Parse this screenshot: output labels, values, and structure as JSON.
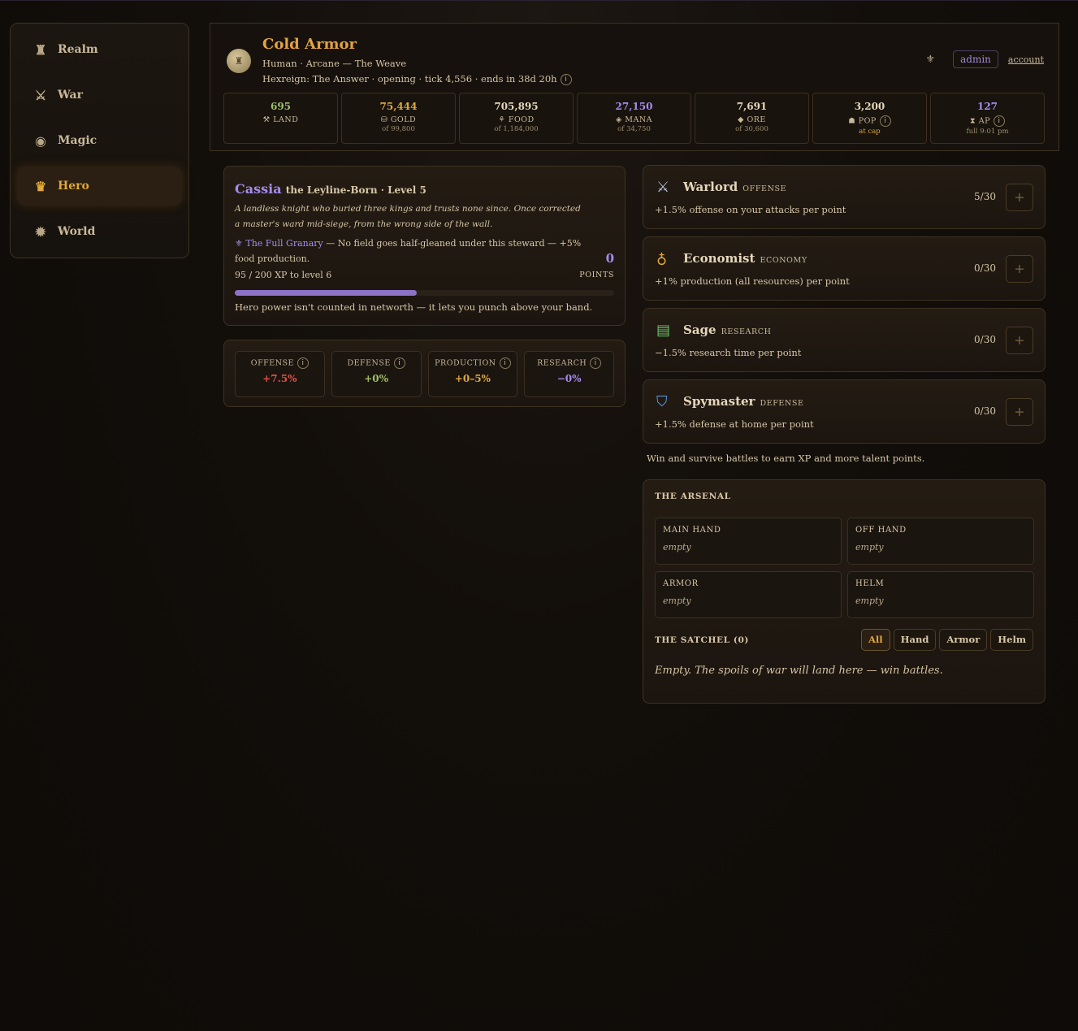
{
  "nav": {
    "items": [
      {
        "label": "Realm",
        "icon": "castle-icon"
      },
      {
        "label": "War",
        "icon": "crossed-swords-icon"
      },
      {
        "label": "Magic",
        "icon": "crystal-ball-icon"
      },
      {
        "label": "Hero",
        "icon": "laurel-icon",
        "active": true
      },
      {
        "label": "World",
        "icon": "compass-icon"
      }
    ]
  },
  "header": {
    "kingdom_name": "Cold Armor",
    "subtitle": "Human · Arcane — The Weave",
    "status": "Hexreign: The Answer · opening · tick 4,556 · ends in 38d 20h",
    "admin_label": "admin",
    "account_label": "account"
  },
  "stats": [
    {
      "value": "695",
      "label": "LAND",
      "sub": "",
      "color": "#9fbf6a"
    },
    {
      "value": "75,444",
      "label": "GOLD",
      "sub": "of 99,800",
      "color": "#e0a73a"
    },
    {
      "value": "705,895",
      "label": "FOOD",
      "sub": "of 1,184,000",
      "color": "#e6d7bb"
    },
    {
      "value": "27,150",
      "label": "MANA",
      "sub": "of 34,750",
      "color": "#a58cf0"
    },
    {
      "value": "7,691",
      "label": "ORE",
      "sub": "of 30,600",
      "color": "#e6d7bb"
    },
    {
      "value": "3,200",
      "label": "POP",
      "sub": "at cap",
      "color": "#e6d7bb"
    },
    {
      "value": "127",
      "label": "AP",
      "sub": "full 9:01 pm",
      "color": "#a58cf0"
    }
  ],
  "hero": {
    "name": "Cassia",
    "title_rest": "the Leyline-Born · Level 5",
    "bio": "A landless knight who buried three kings and trusts none since. Once corrected a master's ward mid-siege, from the wrong side of the wall.",
    "trait_name": "The Full Granary",
    "trait_desc": "— No field goes half-gleaned under this steward — +5% food production.",
    "points": "0",
    "points_label": "POINTS",
    "xp_text": "95 / 200 XP to level 6",
    "xp_fraction": 0.48,
    "note": "Hero power isn't counted in networth — it lets you punch above your band."
  },
  "modifiers": [
    {
      "label": "OFFENSE",
      "value": "+7.5%",
      "color": "#e0514a"
    },
    {
      "label": "DEFENSE",
      "value": "+0%",
      "color": "#9fbf6a"
    },
    {
      "label": "PRODUCTION",
      "value": "+0–5%",
      "color": "#e0a73a"
    },
    {
      "label": "RESEARCH",
      "value": "−0%",
      "color": "#a58cf0"
    }
  ],
  "talents": [
    {
      "name": "Warlord",
      "category": "OFFENSE",
      "desc": "+1.5% offense on your attacks per point",
      "count": "5/30",
      "icon": "swords-icon"
    },
    {
      "name": "Economist",
      "category": "ECONOMY",
      "desc": "+1% production (all resources) per point",
      "count": "0/30",
      "icon": "money-bag-icon"
    },
    {
      "name": "Sage",
      "category": "RESEARCH",
      "desc": "−1.5% research time per point",
      "count": "0/30",
      "icon": "books-icon"
    },
    {
      "name": "Spymaster",
      "category": "DEFENSE",
      "desc": "+1.5% defense at home per point",
      "count": "0/30",
      "icon": "shield-icon"
    }
  ],
  "talent_note": "Win and survive battles to earn XP and more talent points.",
  "arsenal": {
    "title": "THE ARSENAL",
    "slots": [
      {
        "label": "MAIN HAND",
        "value": "empty"
      },
      {
        "label": "OFF HAND",
        "value": "empty"
      },
      {
        "label": "ARMOR",
        "value": "empty"
      },
      {
        "label": "HELM",
        "value": "empty"
      }
    ],
    "satchel_title": "THE SATCHEL (0)",
    "filters": [
      "All",
      "Hand",
      "Armor",
      "Helm"
    ],
    "empty_note": "Empty. The spoils of war will land here — win battles."
  }
}
